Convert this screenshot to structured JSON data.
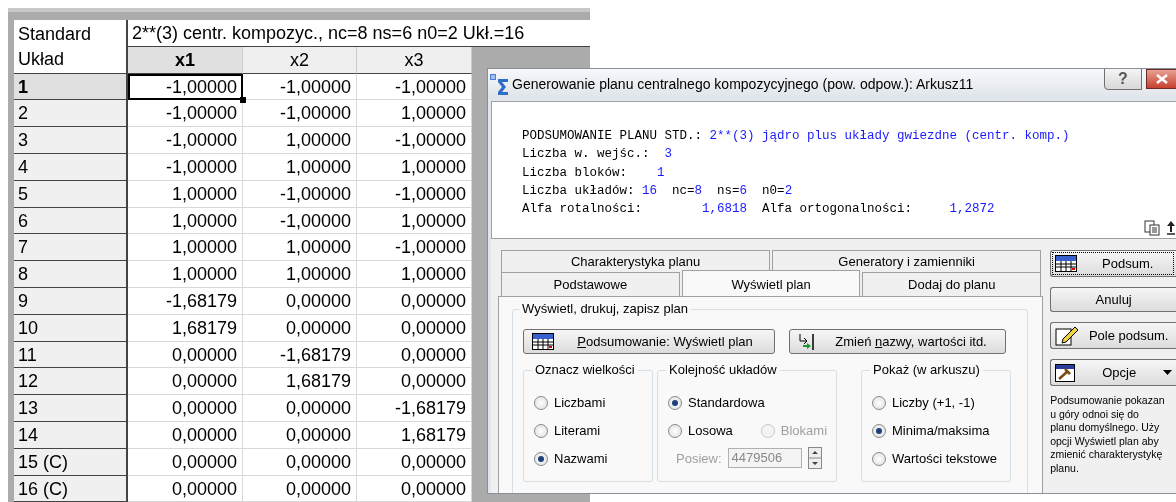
{
  "sheet": {
    "corner": [
      "Standard",
      "Układ"
    ],
    "title": "2**(3) centr. kompozyc., nc=8 ns=6 n0=2 Ukł.=16",
    "columns": [
      {
        "label": "x1",
        "selected": true
      },
      {
        "label": "x2",
        "selected": false
      },
      {
        "label": "x3",
        "selected": false
      }
    ],
    "rows": [
      {
        "label": "1",
        "selected": true,
        "values": [
          "-1,00000",
          "-1,00000",
          "-1,00000"
        ]
      },
      {
        "label": "2",
        "selected": false,
        "values": [
          "-1,00000",
          "-1,00000",
          "1,00000"
        ]
      },
      {
        "label": "3",
        "selected": false,
        "values": [
          "-1,00000",
          "1,00000",
          "-1,00000"
        ]
      },
      {
        "label": "4",
        "selected": false,
        "values": [
          "-1,00000",
          "1,00000",
          "1,00000"
        ]
      },
      {
        "label": "5",
        "selected": false,
        "values": [
          "1,00000",
          "-1,00000",
          "-1,00000"
        ]
      },
      {
        "label": "6",
        "selected": false,
        "values": [
          "1,00000",
          "-1,00000",
          "1,00000"
        ]
      },
      {
        "label": "7",
        "selected": false,
        "values": [
          "1,00000",
          "1,00000",
          "-1,00000"
        ]
      },
      {
        "label": "8",
        "selected": false,
        "values": [
          "1,00000",
          "1,00000",
          "1,00000"
        ]
      },
      {
        "label": "9",
        "selected": false,
        "values": [
          "-1,68179",
          "0,00000",
          "0,00000"
        ]
      },
      {
        "label": "10",
        "selected": false,
        "values": [
          "1,68179",
          "0,00000",
          "0,00000"
        ]
      },
      {
        "label": "11",
        "selected": false,
        "values": [
          "0,00000",
          "-1,68179",
          "0,00000"
        ]
      },
      {
        "label": "12",
        "selected": false,
        "values": [
          "0,00000",
          "1,68179",
          "0,00000"
        ]
      },
      {
        "label": "13",
        "selected": false,
        "values": [
          "0,00000",
          "0,00000",
          "-1,68179"
        ]
      },
      {
        "label": "14",
        "selected": false,
        "values": [
          "0,00000",
          "0,00000",
          "1,68179"
        ]
      },
      {
        "label": "15 (C)",
        "selected": false,
        "values": [
          "0,00000",
          "0,00000",
          "0,00000"
        ]
      },
      {
        "label": "16 (C)",
        "selected": false,
        "values": [
          "0,00000",
          "0,00000",
          "0,00000"
        ]
      }
    ]
  },
  "dialog": {
    "title": "Generowanie planu centralnego kompozycyjnego (pow. odpow.): Arkusz11",
    "help_button": "?",
    "summary": [
      [
        {
          "text": "PODSUMOWANIE PLANU STD.: ",
          "kind": "label"
        },
        {
          "text": "2**(3) jądro plus układy gwiezdne (centr. komp.)",
          "kind": "value"
        }
      ],
      [
        {
          "text": "Liczba w. wejśc.:  ",
          "kind": "label"
        },
        {
          "text": "3",
          "kind": "value"
        }
      ],
      [
        {
          "text": "Liczba bloków:    ",
          "kind": "label"
        },
        {
          "text": "1",
          "kind": "value"
        }
      ],
      [
        {
          "text": "Liczba układów: ",
          "kind": "label"
        },
        {
          "text": "16",
          "kind": "value"
        },
        {
          "text": "  nc=",
          "kind": "label"
        },
        {
          "text": "8",
          "kind": "value"
        },
        {
          "text": "  ns=",
          "kind": "label"
        },
        {
          "text": "6",
          "kind": "value"
        },
        {
          "text": "  n0=",
          "kind": "label"
        },
        {
          "text": "2",
          "kind": "value"
        }
      ],
      [
        {
          "text": "Alfa rotalności:        ",
          "kind": "label"
        },
        {
          "text": "1,6818",
          "kind": "value"
        },
        {
          "text": "  Alfa ortogonalności:     ",
          "kind": "label"
        },
        {
          "text": "1,2872",
          "kind": "value"
        }
      ]
    ],
    "tab_rows": [
      [
        {
          "label": "Charakterystyka planu",
          "selected": false
        },
        {
          "label": "Generatory i zamienniki",
          "selected": false
        }
      ],
      [
        {
          "label": "Podstawowe",
          "selected": false
        },
        {
          "label": "Wyświetl plan",
          "selected": true
        },
        {
          "label": "Dodaj do planu",
          "selected": false
        }
      ]
    ],
    "group_title": "Wyświetl, drukuj, zapisz plan",
    "actions": [
      {
        "label": [
          {
            "text": "P",
            "underline": true
          },
          {
            "text": "odsumowanie: Wyświetl plan",
            "underline": false
          }
        ]
      },
      {
        "label": [
          {
            "text": "Zmień ",
            "underline": false
          },
          {
            "text": "n",
            "underline": true
          },
          {
            "text": "azwy, wartości itd.",
            "underline": false
          }
        ]
      }
    ],
    "option_groups": [
      {
        "title": "Oznacz wielkości",
        "options": [
          {
            "label": "Liczbami",
            "selected": false,
            "disabled": false
          },
          {
            "label": "Literami",
            "selected": false,
            "disabled": false
          },
          {
            "label": "Nazwami",
            "selected": true,
            "disabled": false
          }
        ]
      },
      {
        "title": "Kolejność układów",
        "options": [
          {
            "label": "Standardowa",
            "selected": true,
            "disabled": false
          },
          {
            "label": "Losowa",
            "selected": false,
            "disabled": false
          },
          {
            "label": "Blokami",
            "selected": false,
            "disabled": true
          }
        ],
        "seed": {
          "label": "Posiew:",
          "value": "4479506",
          "disabled": true
        }
      },
      {
        "title": "Pokaż (w arkuszu)",
        "options": [
          {
            "label": "Liczby (+1, -1)",
            "selected": false,
            "disabled": false
          },
          {
            "label": "Minima/maksima",
            "selected": true,
            "disabled": false
          },
          {
            "label": "Wartości tekstowe",
            "selected": false,
            "disabled": false
          }
        ]
      }
    ],
    "side_buttons": [
      {
        "label": "Podsum.",
        "kind": "icon",
        "focused": true
      },
      {
        "label": "Anuluj",
        "kind": "plain",
        "focused": false
      },
      {
        "label": "Pole podsum.",
        "kind": "icon",
        "focused": false
      },
      {
        "label": "Opcje",
        "kind": "menu",
        "focused": false
      }
    ],
    "help_lines": [
      "Podsumowanie pokazan",
      "u góry odnoi się do",
      "planu domyślnego. Uży",
      "opcji Wyświetl plan aby",
      "zmienić charakterystykę",
      "planu."
    ]
  }
}
